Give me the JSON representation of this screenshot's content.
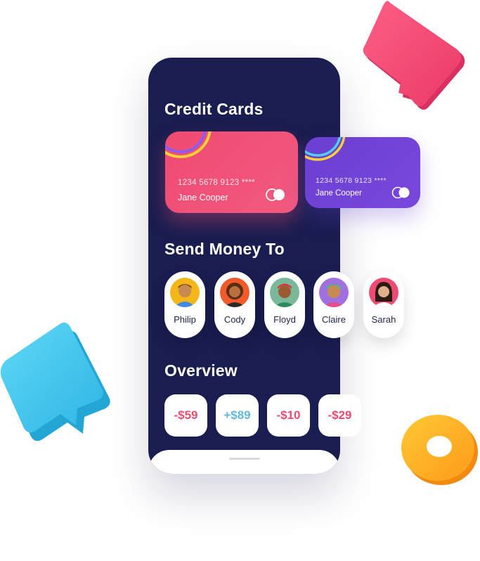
{
  "sections": {
    "cards_title": "Credit Cards",
    "send_title": "Send Money To",
    "overview_title": "Overview"
  },
  "cards": [
    {
      "number": "1234 5678 9123 ****",
      "holder": "Jane Cooper",
      "color": "#ef4a72"
    },
    {
      "number": "1234 5678 9123 ****",
      "holder": "Jane Cooper",
      "color": "#6a3fd2"
    }
  ],
  "contacts": [
    {
      "name": "Philip",
      "avatar_color": "#f5b718"
    },
    {
      "name": "Cody",
      "avatar_color": "#f15a2b"
    },
    {
      "name": "Floyd",
      "avatar_color": "#7ab89a"
    },
    {
      "name": "Claire",
      "avatar_color": "#a070e0"
    },
    {
      "name": "Sarah",
      "avatar_color": "#ef4a72"
    }
  ],
  "overview": [
    {
      "amount": "-$59",
      "color": "#ef4a72"
    },
    {
      "amount": "+$89",
      "color": "#62b7dd"
    },
    {
      "amount": "-$10",
      "color": "#ef4a72"
    },
    {
      "amount": "-$29",
      "color": "#ef4a72"
    }
  ],
  "colors": {
    "phone_bg": "#191d4f",
    "accent_pink": "#ef4a72",
    "accent_purple": "#6a3fd2",
    "accent_blue": "#62b7dd"
  },
  "icons": {
    "card_logo": "mastercard-circles-icon",
    "decor_pink": "chat-bubble-icon",
    "decor_blue": "chat-bubble-icon",
    "decor_ring": "ring-icon"
  }
}
